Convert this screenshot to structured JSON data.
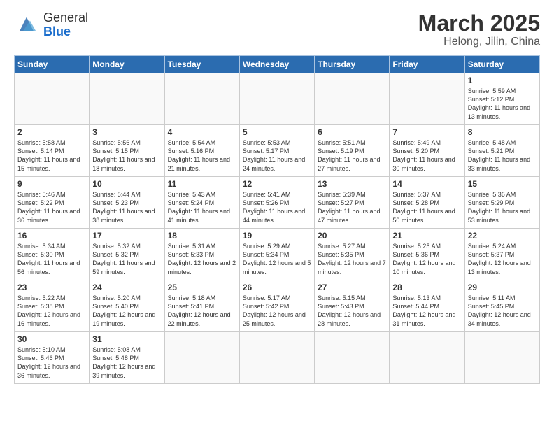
{
  "logo": {
    "general": "General",
    "blue": "Blue"
  },
  "title": "March 2025",
  "subtitle": "Helong, Jilin, China",
  "weekdays": [
    "Sunday",
    "Monday",
    "Tuesday",
    "Wednesday",
    "Thursday",
    "Friday",
    "Saturday"
  ],
  "weeks": [
    [
      {
        "day": null
      },
      {
        "day": null
      },
      {
        "day": null
      },
      {
        "day": null
      },
      {
        "day": null
      },
      {
        "day": null
      },
      {
        "day": 1,
        "sunrise": "5:59 AM",
        "sunset": "5:12 PM",
        "daylight": "11 hours and 13 minutes."
      }
    ],
    [
      {
        "day": 2,
        "sunrise": "5:58 AM",
        "sunset": "5:14 PM",
        "daylight": "11 hours and 15 minutes."
      },
      {
        "day": 3,
        "sunrise": "5:56 AM",
        "sunset": "5:15 PM",
        "daylight": "11 hours and 18 minutes."
      },
      {
        "day": 4,
        "sunrise": "5:54 AM",
        "sunset": "5:16 PM",
        "daylight": "11 hours and 21 minutes."
      },
      {
        "day": 5,
        "sunrise": "5:53 AM",
        "sunset": "5:17 PM",
        "daylight": "11 hours and 24 minutes."
      },
      {
        "day": 6,
        "sunrise": "5:51 AM",
        "sunset": "5:19 PM",
        "daylight": "11 hours and 27 minutes."
      },
      {
        "day": 7,
        "sunrise": "5:49 AM",
        "sunset": "5:20 PM",
        "daylight": "11 hours and 30 minutes."
      },
      {
        "day": 8,
        "sunrise": "5:48 AM",
        "sunset": "5:21 PM",
        "daylight": "11 hours and 33 minutes."
      }
    ],
    [
      {
        "day": 9,
        "sunrise": "5:46 AM",
        "sunset": "5:22 PM",
        "daylight": "11 hours and 36 minutes."
      },
      {
        "day": 10,
        "sunrise": "5:44 AM",
        "sunset": "5:23 PM",
        "daylight": "11 hours and 38 minutes."
      },
      {
        "day": 11,
        "sunrise": "5:43 AM",
        "sunset": "5:24 PM",
        "daylight": "11 hours and 41 minutes."
      },
      {
        "day": 12,
        "sunrise": "5:41 AM",
        "sunset": "5:26 PM",
        "daylight": "11 hours and 44 minutes."
      },
      {
        "day": 13,
        "sunrise": "5:39 AM",
        "sunset": "5:27 PM",
        "daylight": "11 hours and 47 minutes."
      },
      {
        "day": 14,
        "sunrise": "5:37 AM",
        "sunset": "5:28 PM",
        "daylight": "11 hours and 50 minutes."
      },
      {
        "day": 15,
        "sunrise": "5:36 AM",
        "sunset": "5:29 PM",
        "daylight": "11 hours and 53 minutes."
      }
    ],
    [
      {
        "day": 16,
        "sunrise": "5:34 AM",
        "sunset": "5:30 PM",
        "daylight": "11 hours and 56 minutes."
      },
      {
        "day": 17,
        "sunrise": "5:32 AM",
        "sunset": "5:32 PM",
        "daylight": "11 hours and 59 minutes."
      },
      {
        "day": 18,
        "sunrise": "5:31 AM",
        "sunset": "5:33 PM",
        "daylight": "12 hours and 2 minutes."
      },
      {
        "day": 19,
        "sunrise": "5:29 AM",
        "sunset": "5:34 PM",
        "daylight": "12 hours and 5 minutes."
      },
      {
        "day": 20,
        "sunrise": "5:27 AM",
        "sunset": "5:35 PM",
        "daylight": "12 hours and 7 minutes."
      },
      {
        "day": 21,
        "sunrise": "5:25 AM",
        "sunset": "5:36 PM",
        "daylight": "12 hours and 10 minutes."
      },
      {
        "day": 22,
        "sunrise": "5:24 AM",
        "sunset": "5:37 PM",
        "daylight": "12 hours and 13 minutes."
      }
    ],
    [
      {
        "day": 23,
        "sunrise": "5:22 AM",
        "sunset": "5:38 PM",
        "daylight": "12 hours and 16 minutes."
      },
      {
        "day": 24,
        "sunrise": "5:20 AM",
        "sunset": "5:40 PM",
        "daylight": "12 hours and 19 minutes."
      },
      {
        "day": 25,
        "sunrise": "5:18 AM",
        "sunset": "5:41 PM",
        "daylight": "12 hours and 22 minutes."
      },
      {
        "day": 26,
        "sunrise": "5:17 AM",
        "sunset": "5:42 PM",
        "daylight": "12 hours and 25 minutes."
      },
      {
        "day": 27,
        "sunrise": "5:15 AM",
        "sunset": "5:43 PM",
        "daylight": "12 hours and 28 minutes."
      },
      {
        "day": 28,
        "sunrise": "5:13 AM",
        "sunset": "5:44 PM",
        "daylight": "12 hours and 31 minutes."
      },
      {
        "day": 29,
        "sunrise": "5:11 AM",
        "sunset": "5:45 PM",
        "daylight": "12 hours and 34 minutes."
      }
    ],
    [
      {
        "day": 30,
        "sunrise": "5:10 AM",
        "sunset": "5:46 PM",
        "daylight": "12 hours and 36 minutes."
      },
      {
        "day": 31,
        "sunrise": "5:08 AM",
        "sunset": "5:48 PM",
        "daylight": "12 hours and 39 minutes."
      },
      {
        "day": null
      },
      {
        "day": null
      },
      {
        "day": null
      },
      {
        "day": null
      },
      {
        "day": null
      }
    ]
  ]
}
